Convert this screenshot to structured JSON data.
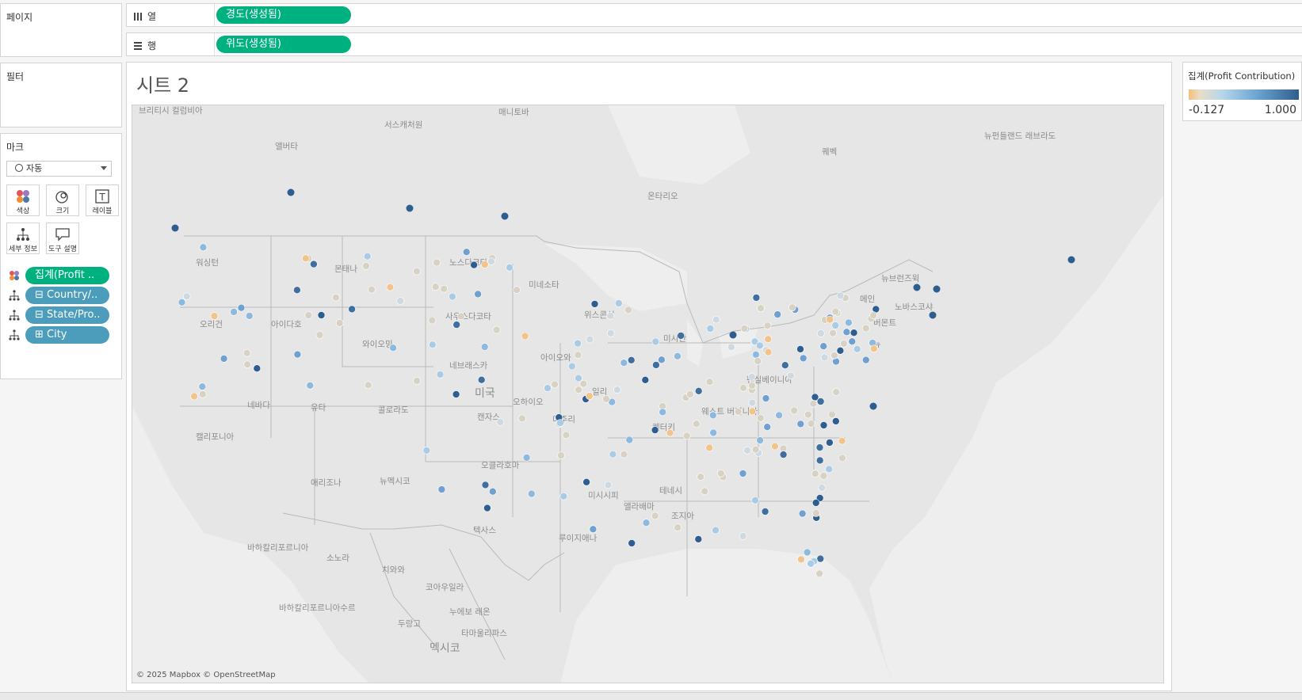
{
  "left_panels": {
    "pages_title": "페이지",
    "filters_title": "필터",
    "marks_title": "마크",
    "mark_type": "자동",
    "cards": [
      {
        "label": "색상",
        "icon": "color-icon"
      },
      {
        "label": "크기",
        "icon": "size-icon"
      },
      {
        "label": "레이블",
        "icon": "label-icon"
      },
      {
        "label": "세부 정보",
        "icon": "detail-icon"
      },
      {
        "label": "도구 설명",
        "icon": "tooltip-icon"
      }
    ],
    "mark_fields": [
      {
        "label": "집계(Profit ..",
        "kind": "color"
      },
      {
        "label": "⊟ Country/..",
        "kind": "detail"
      },
      {
        "label": "⊟ State/Pro..",
        "kind": "detail"
      },
      {
        "label": "⊞ City",
        "kind": "detail"
      }
    ]
  },
  "shelves": {
    "columns_label": "열",
    "columns_pill": "경도(생성됨)",
    "rows_label": "행",
    "rows_pill": "위도(생성됨)"
  },
  "sheet": {
    "title": "시트 2",
    "attribution": "© 2025 Mapbox © OpenStreetMap"
  },
  "legend": {
    "title": "집계(Profit Contribution)",
    "min": "-0.127",
    "max": "1.000",
    "colors": {
      "low": "#f5c07a",
      "mid": "#b9d6ea",
      "high": "#2e5d8f"
    }
  },
  "map_labels": [
    "브리티시 컬럼비아",
    "서스캐처원",
    "매니토바",
    "앨버타",
    "온타리오",
    "퀘벡",
    "뉴펀들랜드 래브라도",
    "워싱턴",
    "몬태나",
    "노스다코타",
    "미네소타",
    "메인",
    "뉴브런즈윅",
    "노바스코샤",
    "오리건",
    "아이다호",
    "사우스다코타",
    "위스콘신",
    "미시간",
    "버몬트",
    "뉴",
    "와이오밍",
    "네브래스카",
    "아이오와",
    "펜실베이니아",
    "미국",
    "일리",
    "오하이오",
    "네바다",
    "유타",
    "콜로라도",
    "캔자스",
    "미주리",
    "웨스트 버지니아",
    "켄터키",
    "캘리포니아",
    "오클라호마",
    "애리조나",
    "뉴멕시코",
    "테네시",
    "미시시피",
    "앨라배마",
    "조지아",
    "텍사스",
    "루이지애나",
    "바하칼리포르니아",
    "소노라",
    "치와와",
    "코아우일라",
    "누에보 레온",
    "바하칼리포르니아수르",
    "두랑고",
    "타마울리파스",
    "멕시코"
  ]
}
